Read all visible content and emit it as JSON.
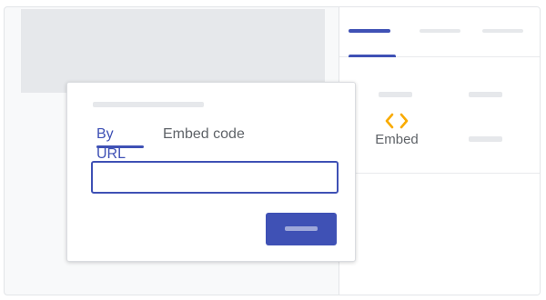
{
  "colors": {
    "accent": "#3f51b5",
    "embed_icon": "#f9ab00",
    "placeholder": "#e6e8eb",
    "muted_text": "#5f6368"
  },
  "dialog": {
    "tabs": [
      {
        "label": "By URL",
        "active": true
      },
      {
        "label": "Embed code",
        "active": false
      }
    ],
    "url_input": {
      "value": "",
      "placeholder": ""
    }
  },
  "right_panel": {
    "embed_tile": {
      "label": "Embed",
      "icon": "code-brackets-icon"
    }
  }
}
